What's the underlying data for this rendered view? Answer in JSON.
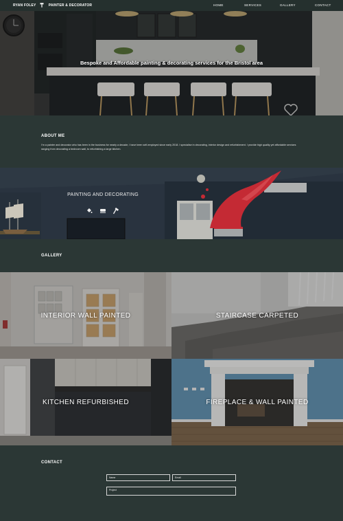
{
  "nav": {
    "brand_name": "RYAN FOLEY",
    "brand_role": "PAINTER & DECORATOR",
    "links": [
      "HOME",
      "SERVICES",
      "GALLERY",
      "CONTACT"
    ]
  },
  "hero": {
    "tagline": "Bespoke and Affordable painting & decorating services for the Bristol area"
  },
  "about": {
    "heading": "ABOUT ME",
    "text": "I'm a painter and decorator who has been in the business for nearly a decade, I have been self-employed since early 2018. I specialise in decorating, interior design and refurbishment. I provide high quality yet affordable services ranging from decorating a bedroom wall, to refurbishing a large kitchen."
  },
  "services": {
    "title": "PAINTING AND DECORATING",
    "icons": [
      "paint-bucket-icon",
      "roller-icon",
      "hammer-icon"
    ]
  },
  "gallery": {
    "heading": "GALLERY",
    "items": [
      "INTERIOR WALL PAINTED",
      "STAIRCASE CARPETED",
      "KITCHEN REFURBISHED",
      "FIREPLACE & WALL PAINTED"
    ]
  },
  "contact": {
    "heading": "CONTACT",
    "name_placeholder": "Name",
    "email_placeholder": "Email",
    "project_placeholder": "Project"
  },
  "colors": {
    "background": "#2b3735",
    "nav": "#25302e",
    "text": "#ffffff",
    "paint_accent": "#e0303c"
  }
}
